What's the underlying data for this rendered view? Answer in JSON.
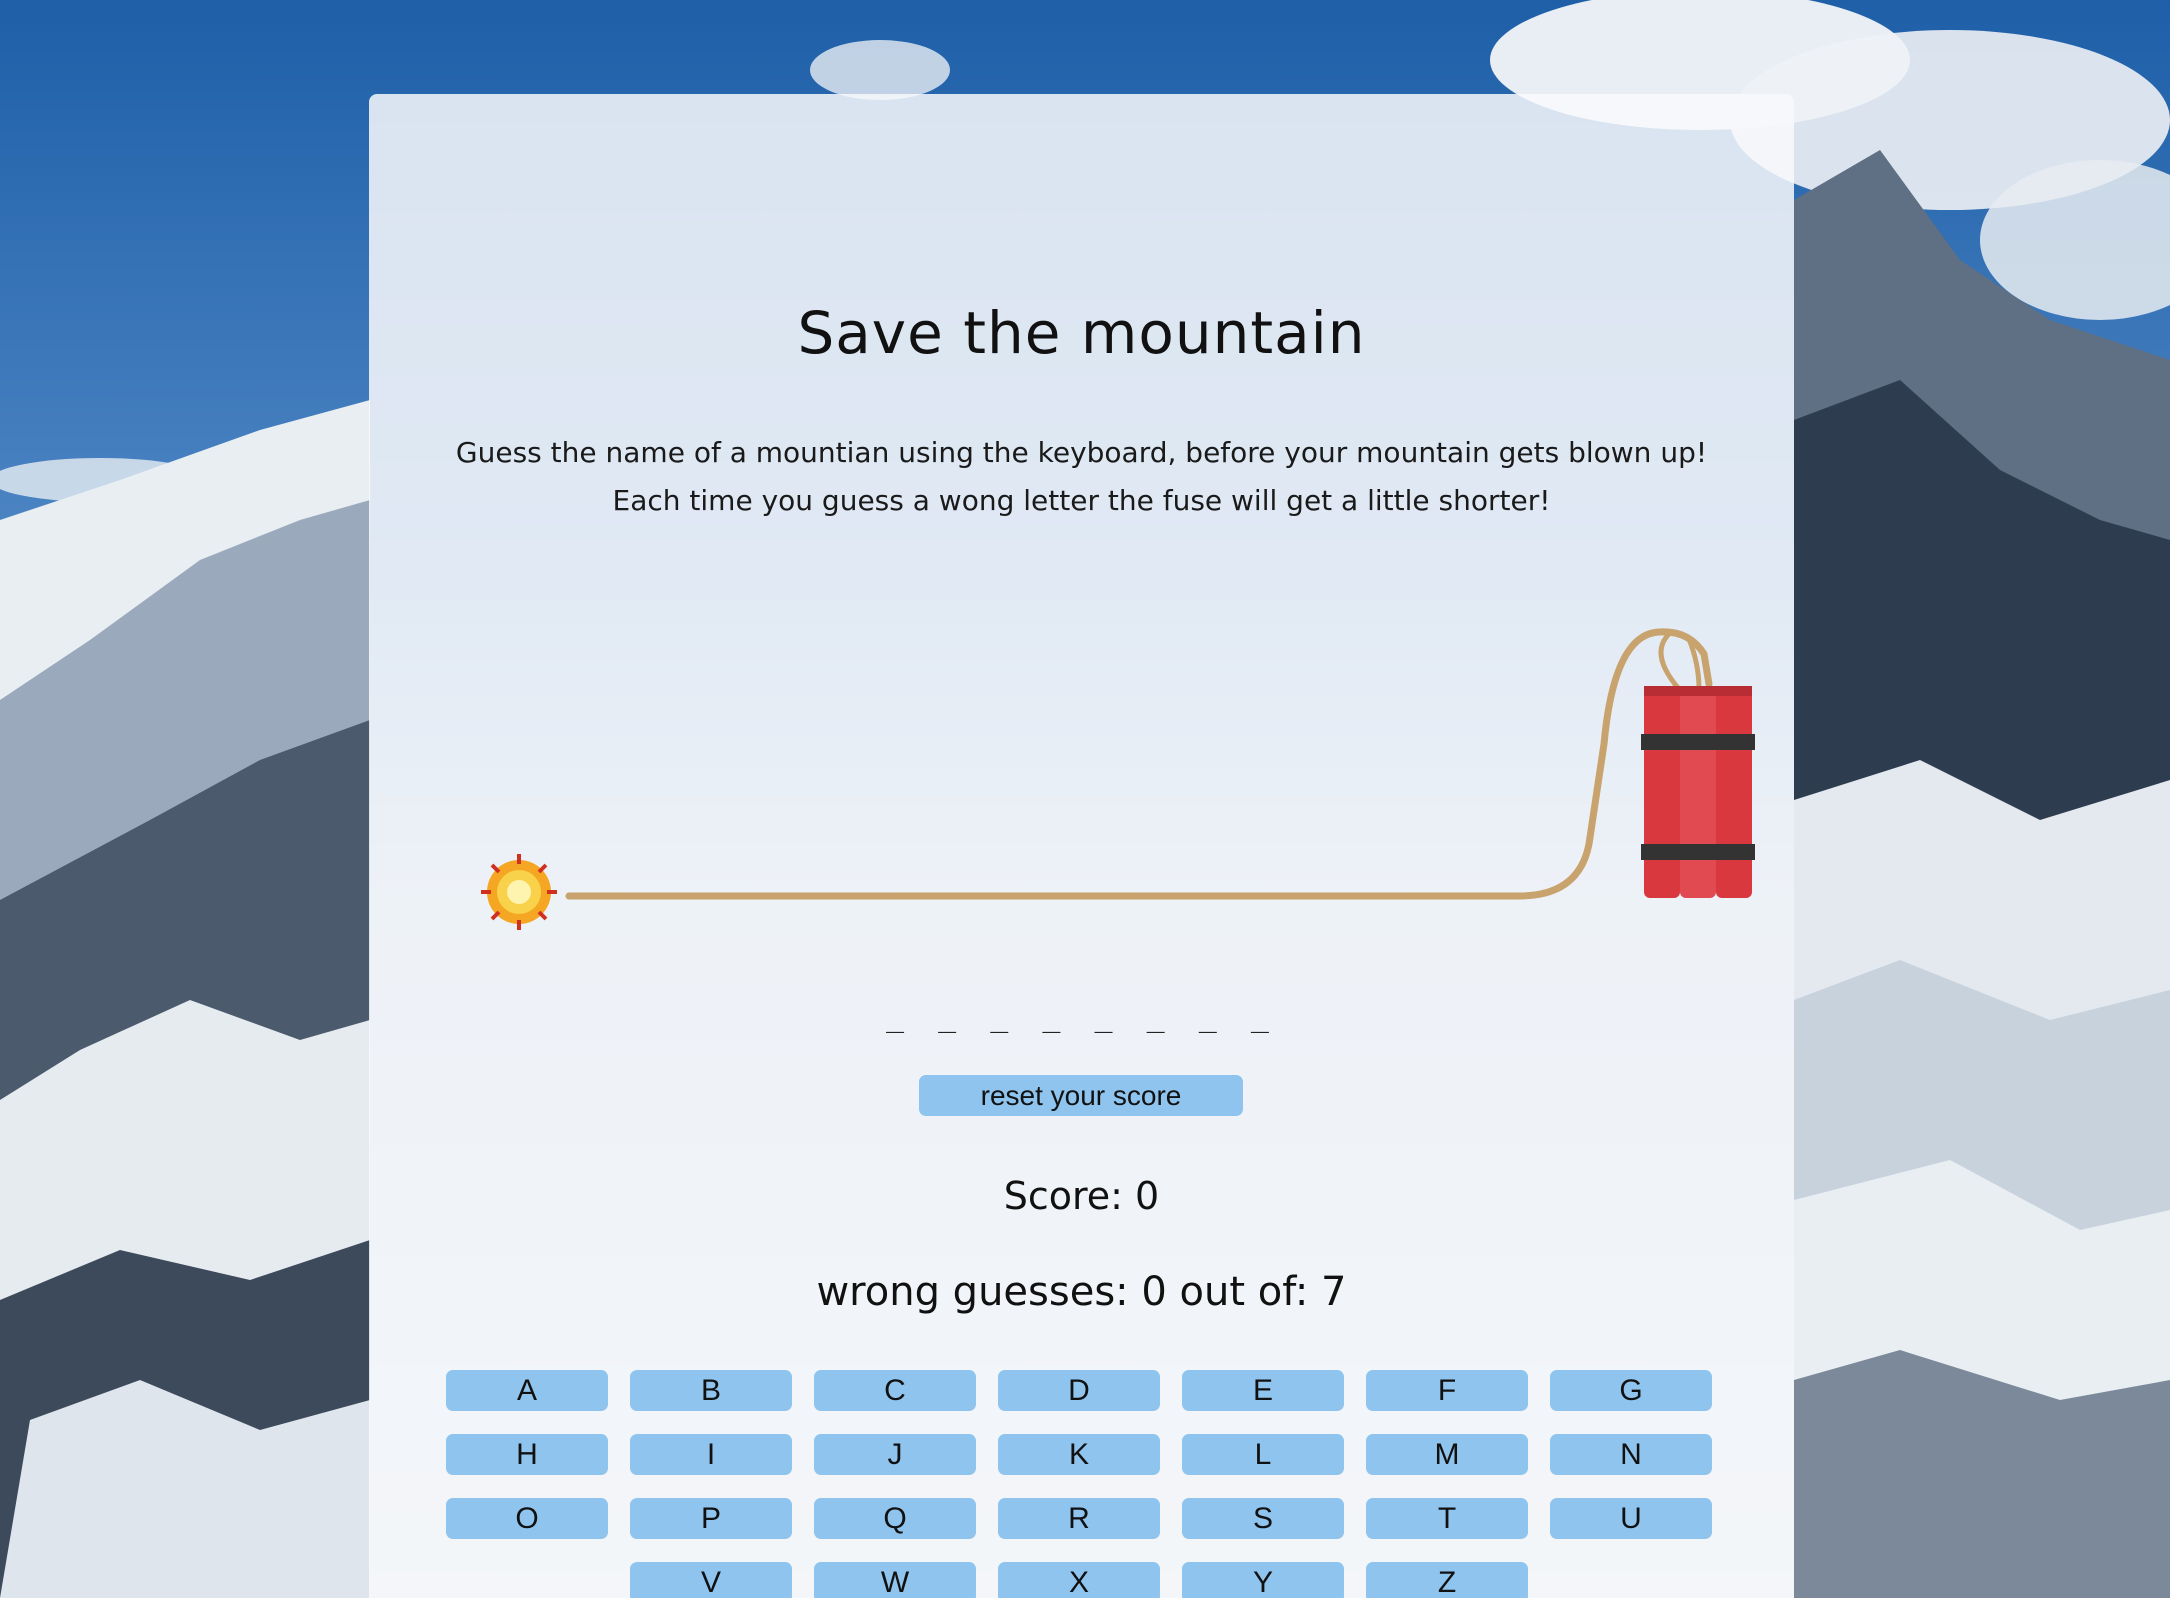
{
  "game": {
    "title": "Save the mountain",
    "intro": "Guess the name of a mountian using the keyboard, before your mountain gets blown up! Each time you guess a wong letter the fuse will get a little shorter!",
    "word_display": "_ _ _ _ _ _ _ _",
    "reset_label": "reset your score",
    "score_text": "Score: 0",
    "wrong_text": "wrong guesses: 0 out of: 7"
  },
  "keyboard": {
    "keys": [
      "A",
      "B",
      "C",
      "D",
      "E",
      "F",
      "G",
      "H",
      "I",
      "J",
      "K",
      "L",
      "M",
      "N",
      "O",
      "P",
      "Q",
      "R",
      "S",
      "T",
      "U",
      "V",
      "W",
      "X",
      "Y",
      "Z"
    ]
  },
  "colors": {
    "button": "#8fc4ee",
    "fuse": "#c8a36e",
    "dynamite": "#d9383f",
    "panel": "#f8f9fb"
  },
  "icons": {
    "spark": "spark-icon",
    "dynamite": "dynamite-icon"
  }
}
